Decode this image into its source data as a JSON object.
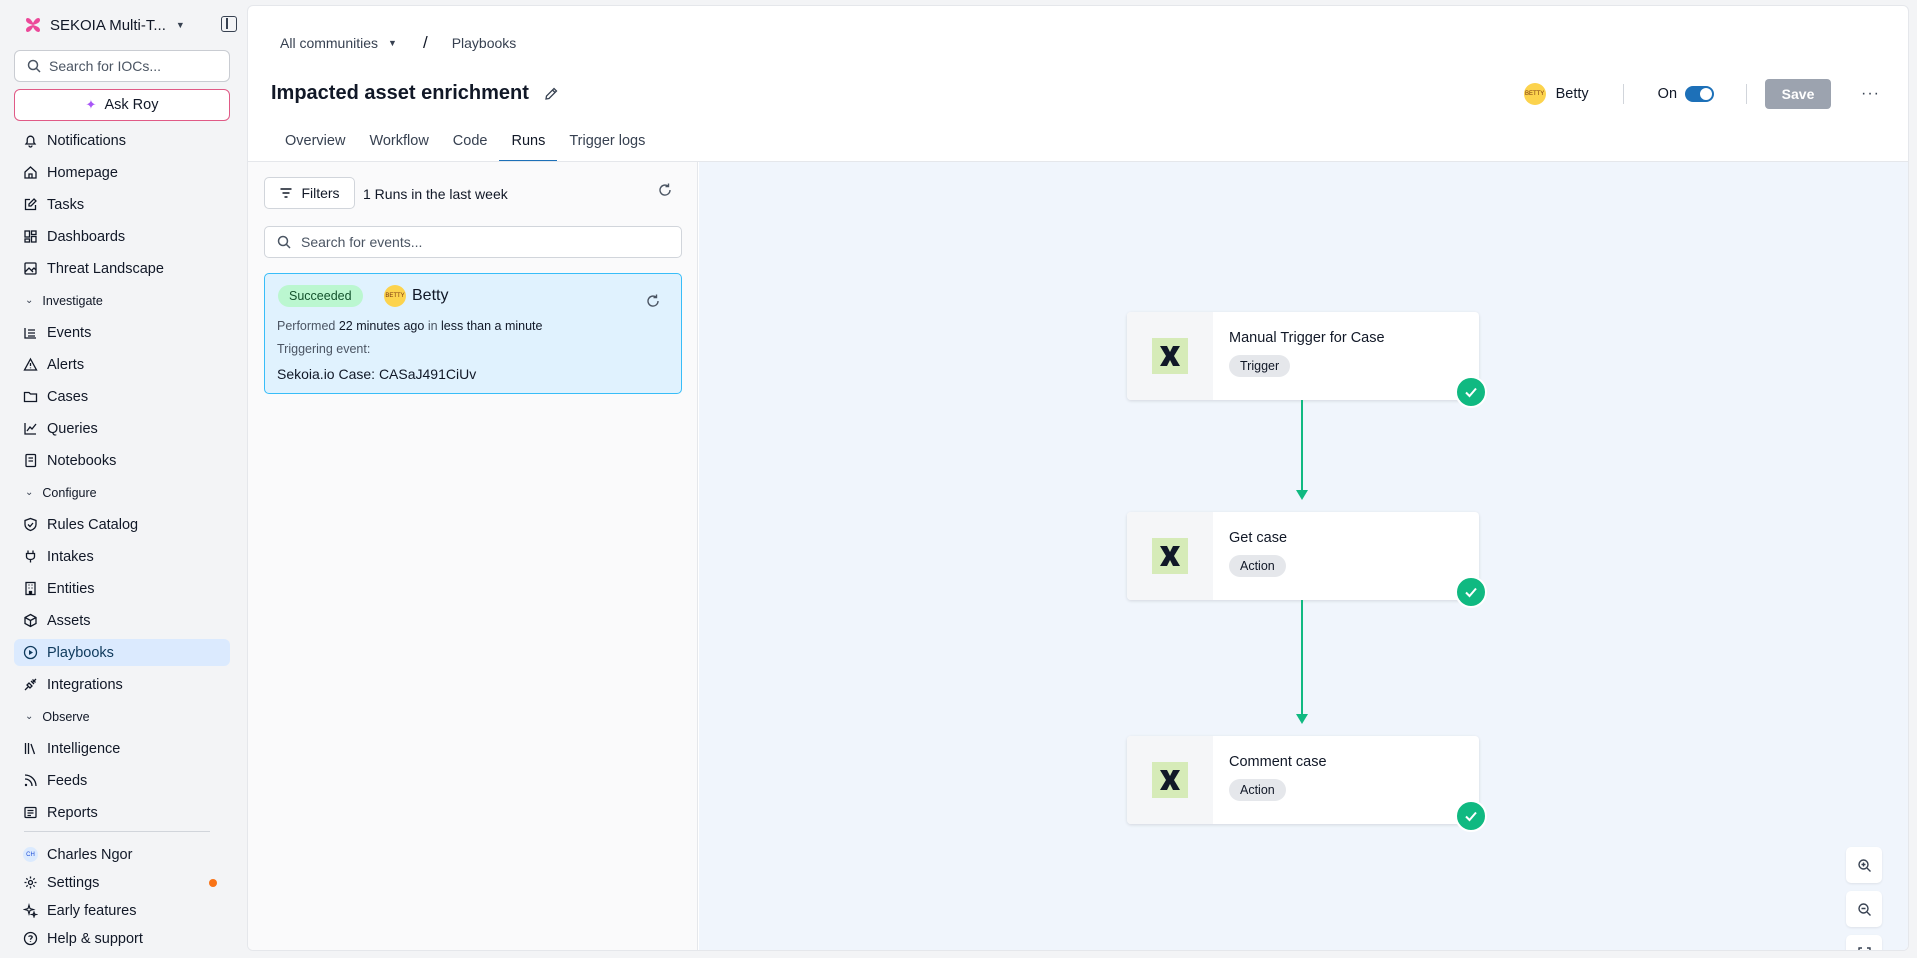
{
  "sidebar": {
    "workspace": "SEKOIA Multi-T...",
    "search_placeholder": "Search for IOCs...",
    "ask_label": "Ask Roy",
    "items": [
      {
        "label": "Notifications"
      },
      {
        "label": "Homepage"
      },
      {
        "label": "Tasks"
      },
      {
        "label": "Dashboards"
      },
      {
        "label": "Threat Landscape"
      }
    ],
    "investigate": {
      "title": "Investigate",
      "items": [
        {
          "label": "Events"
        },
        {
          "label": "Alerts"
        },
        {
          "label": "Cases"
        },
        {
          "label": "Queries"
        },
        {
          "label": "Notebooks"
        }
      ]
    },
    "configure": {
      "title": "Configure",
      "items": [
        {
          "label": "Rules Catalog"
        },
        {
          "label": "Intakes"
        },
        {
          "label": "Entities"
        },
        {
          "label": "Assets"
        },
        {
          "label": "Playbooks"
        },
        {
          "label": "Integrations"
        }
      ]
    },
    "observe": {
      "title": "Observe",
      "items": [
        {
          "label": "Intelligence"
        },
        {
          "label": "Feeds"
        },
        {
          "label": "Reports"
        }
      ]
    },
    "user": {
      "name": "Charles Ngor",
      "initials": "CH"
    },
    "bottom": [
      {
        "label": "Settings"
      },
      {
        "label": "Early features"
      },
      {
        "label": "Help & support"
      }
    ],
    "active_item": "Playbooks"
  },
  "header": {
    "breadcrumb_root": "All communities",
    "breadcrumb_sep": "/",
    "breadcrumb_current": "Playbooks",
    "title": "Impacted asset enrichment",
    "owner": "Betty",
    "status_label": "On",
    "save_label": "Save",
    "more_label": "···"
  },
  "tabs": [
    {
      "label": "Overview"
    },
    {
      "label": "Workflow"
    },
    {
      "label": "Code"
    },
    {
      "label": "Runs"
    },
    {
      "label": "Trigger logs"
    }
  ],
  "active_tab": "Runs",
  "runs": {
    "filters_label": "Filters",
    "count_label": "1 Runs in the last week",
    "search_placeholder": "Search for events...",
    "card": {
      "status": "Succeeded",
      "user": "Betty",
      "performed_prefix": "Performed",
      "performed_time": "22 minutes ago",
      "performed_in": "in",
      "duration": "less than a minute",
      "triggering_label": "Triggering event:",
      "triggering_value": "Sekoia.io Case: CASaJ491CiUv"
    }
  },
  "workflow": {
    "nodes": [
      {
        "name": "Manual Trigger for Case",
        "type": "Trigger",
        "status": "success"
      },
      {
        "name": "Get case",
        "type": "Action",
        "status": "success"
      },
      {
        "name": "Comment case",
        "type": "Action",
        "status": "success"
      }
    ]
  },
  "colors": {
    "accent": "#1d70b8",
    "success": "#10b981",
    "active_nav_bg": "#dbeafe",
    "canvas_bg": "#f0f5fc"
  }
}
